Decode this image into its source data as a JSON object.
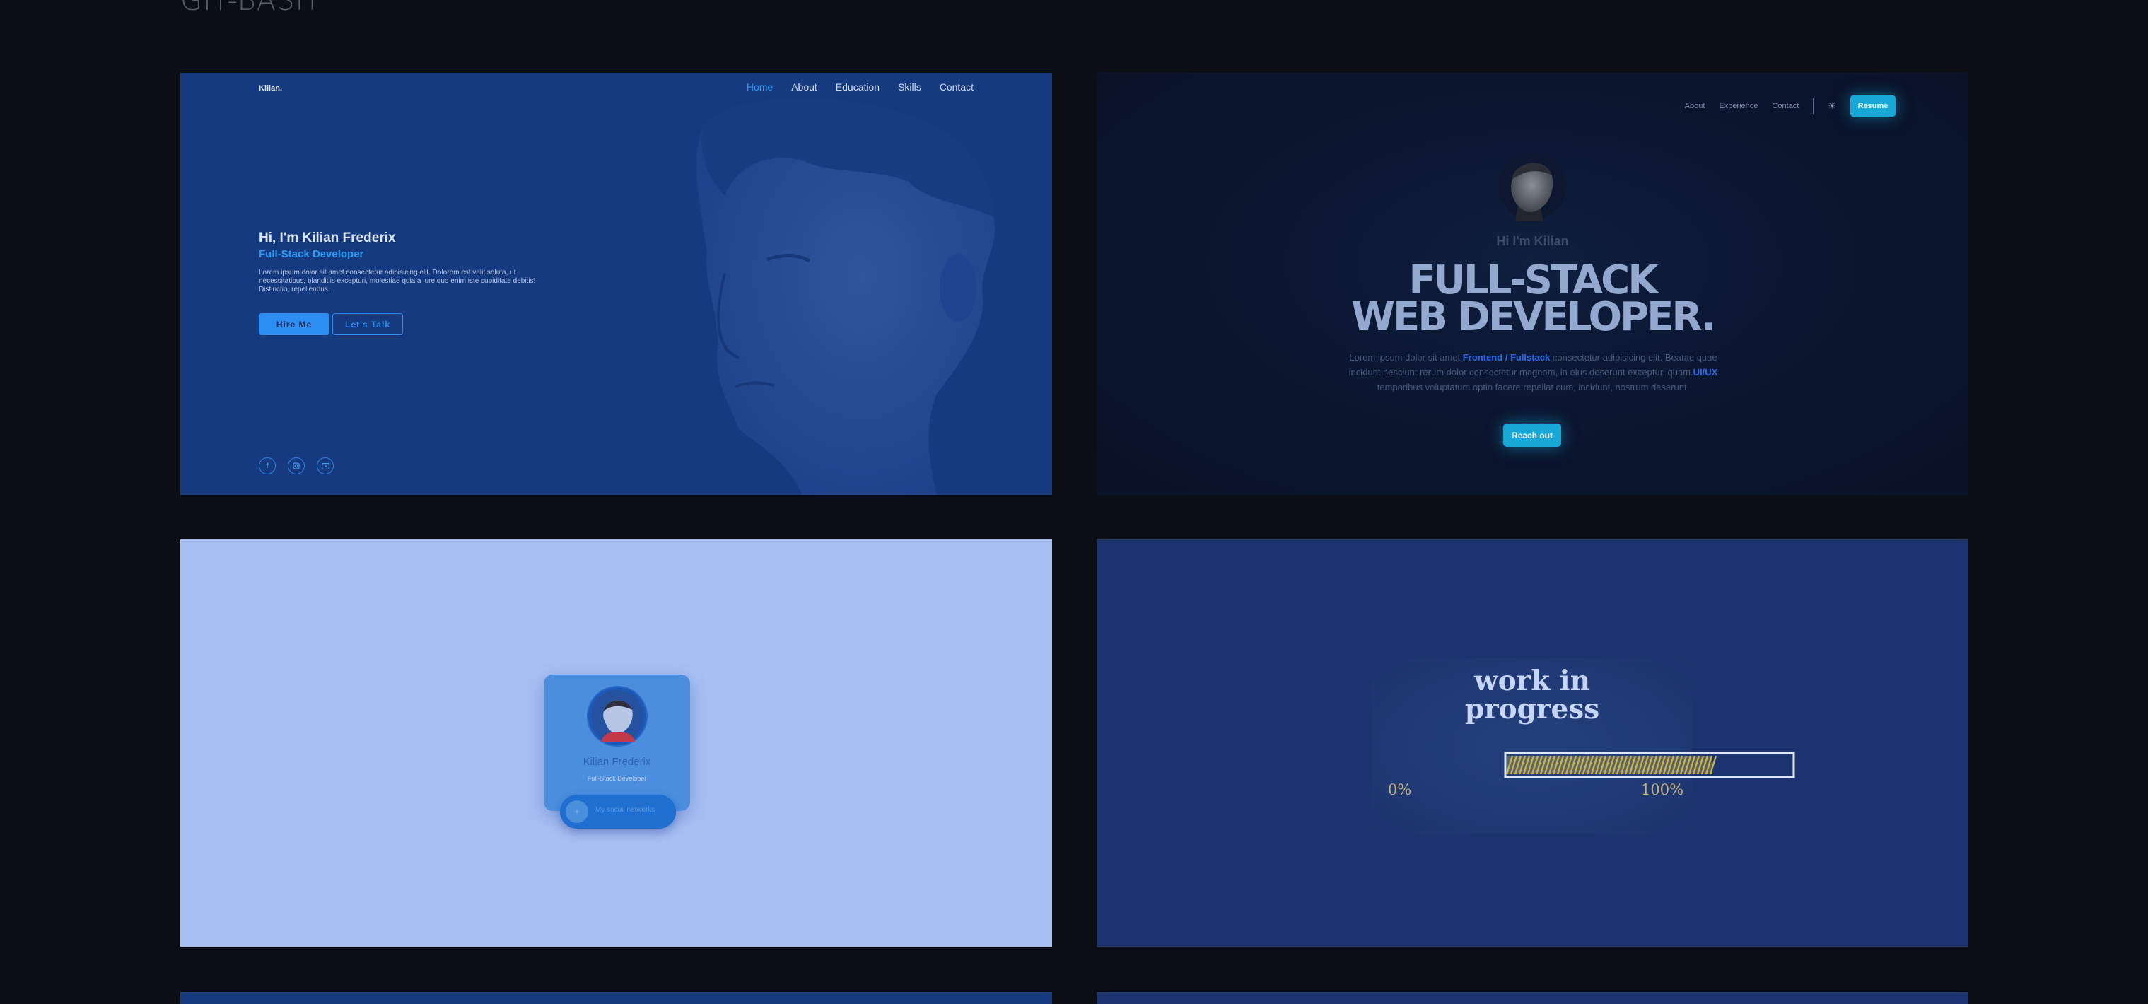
{
  "heading": "GIT-BASH",
  "card1": {
    "brand": "Kilian.",
    "nav": [
      "Home",
      "About",
      "Education",
      "Skills",
      "Contact"
    ],
    "title": "Hi, I'm Kilian Frederix",
    "subtitle": "Full-Stack Developer",
    "description": "Lorem ipsum dolor sit amet consectetur adipisicing elit. Dolorem est velit soluta, ut necessitatibus, blanditiis excepturi, molestiae quia a iure quo enim iste cupiditate debitis! Distinctio, repellendus.",
    "hire_button": "Hire Me",
    "talk_button": "Let's Talk",
    "socials": [
      "facebook-icon",
      "instagram-icon",
      "youtube-icon"
    ],
    "colors": {
      "background": "#153a80",
      "accent": "#2c9bf5"
    }
  },
  "card2": {
    "nav": [
      "About",
      "Experience",
      "Contact"
    ],
    "resume_button": "Resume",
    "greeting": "Hi I'm Kilian",
    "headline_line1": "FULL-STACK",
    "headline_line2": "WEB DEVELOPER.",
    "para_part1": "Lorem ipsum dolor sit amet ",
    "para_highlight1": "Frontend / Fullstack",
    "para_part2": " consectetur adipisicing elit. Beatae quae incidunt nesciunt rerum dolor consectetur magnam, in eius deserunt excepturi quam.",
    "para_highlight2": "UI/UX",
    "para_part3": " temporibus voluptatum optio facere repellat cum, incidunt, nostrum deserunt.",
    "reach_button": "Reach out",
    "colors": {
      "accent": "#18a8d8",
      "highlight": "#2a6bf0"
    }
  },
  "card3": {
    "name": "Kilian Frederix",
    "role": "Full-Stack Developer",
    "social_label": "My social networks",
    "plus_icon": "+",
    "colors": {
      "background": "#a8bff3",
      "card": "#4b8ede"
    }
  },
  "card4": {
    "title_line1": "work in",
    "title_line2": "progress",
    "progress": 0.72,
    "min_label": "0%",
    "max_label": "100%",
    "colors": {
      "fill": "#c9b24a",
      "chalk": "#c6d6f8"
    }
  }
}
